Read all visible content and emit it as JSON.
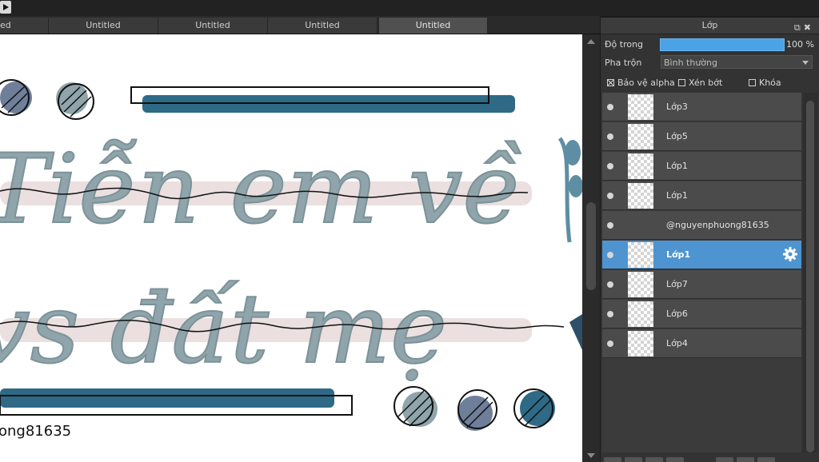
{
  "tabs": [
    {
      "label": "ed"
    },
    {
      "label": "Untitled"
    },
    {
      "label": "Untitled"
    },
    {
      "label": "Untitled"
    },
    {
      "label": "Untitled"
    }
  ],
  "canvas": {
    "line1": "Tiễn em về",
    "line2": "vs đất mẹ",
    "signature": "ong81635",
    "colors": {
      "teal_dark": "#2e6a86",
      "slate_blue": "#6f7f9a",
      "mint_gray": "#8fa5ab",
      "pink": "#e8d9d9"
    }
  },
  "layer_panel": {
    "title": "Lớp",
    "opacity_label": "Độ trong",
    "opacity_value": "100 %",
    "opacity_fraction": 1.0,
    "blend_label": "Pha trộn",
    "blend_value": "Bình thường",
    "protect_alpha_label": "Bảo vệ alpha",
    "clip_label": "Xén bớt",
    "lock_label": "Khóa",
    "protect_alpha_checked": true,
    "clip_checked": false,
    "lock_checked": false,
    "layers": [
      {
        "name": "Lớp3",
        "selected": false
      },
      {
        "name": "Lớp5",
        "selected": false
      },
      {
        "name": "Lớp1",
        "selected": false
      },
      {
        "name": "Lớp1",
        "selected": false
      },
      {
        "name": "@nguyenphuong81635",
        "selected": false
      },
      {
        "name": "Lớp1",
        "selected": true
      },
      {
        "name": "Lớp7",
        "selected": false
      },
      {
        "name": "Lớp6",
        "selected": false
      },
      {
        "name": "Lớp4",
        "selected": false
      }
    ]
  }
}
